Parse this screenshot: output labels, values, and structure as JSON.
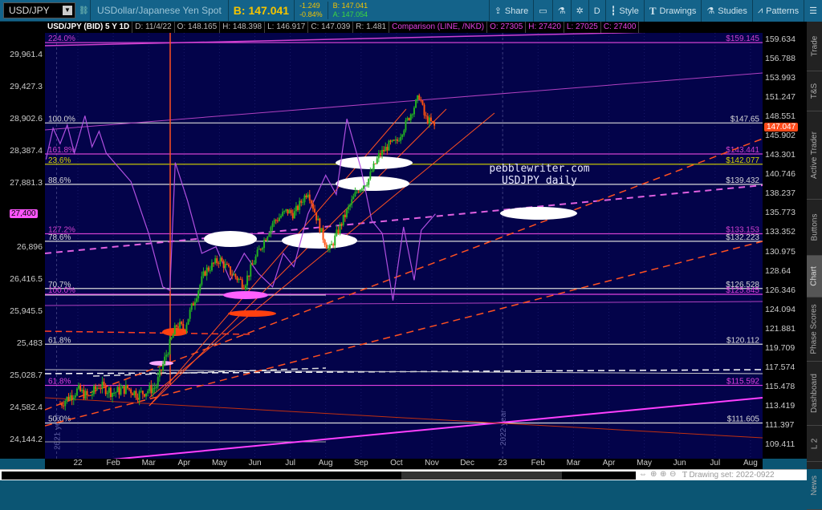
{
  "toolbar": {
    "symbol": "USD/JPY",
    "description": "USDollar/Japanese Yen Spot",
    "bid_big": "B: 147.041",
    "change": "-1.249",
    "change_pct": "-0.84%",
    "bid": "B: 147.041",
    "ask": "A: 147.054",
    "share": "Share",
    "aggregation": "D",
    "style": "Style",
    "drawings": "Drawings",
    "studies": "Studies",
    "patterns": "Patterns"
  },
  "header": {
    "title": "USD/JPY (BID) 5 Y 1D",
    "date": "D: 11/4/22",
    "open": "O: 148.165",
    "high": "H: 148.398",
    "low": "L: 146.917",
    "close": "C: 147.039",
    "range": "R: 1.481",
    "comparison": "Comparison (LINE, /NKD)",
    "cmp_open": "O: 27305",
    "cmp_high": "H: 27420",
    "cmp_low": "L: 27025",
    "cmp_close": "C: 27400"
  },
  "right_axis": [
    "159.634",
    "156.788",
    "153.993",
    "151.247",
    "148.551",
    "145.902",
    "143.301",
    "140.746",
    "138.237",
    "135.773",
    "133.352",
    "130.975",
    "128.64",
    "126.346",
    "124.094",
    "121.881",
    "119.709",
    "117.574",
    "115.478",
    "113.419",
    "111.397",
    "109.411"
  ],
  "left_axis": [
    "29,961.4",
    "29,427.3",
    "28,902.6",
    "28,387.4",
    "27,881.3",
    "26,896",
    "26,416.5",
    "25,945.5",
    "25,483",
    "25,028.7",
    "24,582.4",
    "24,144.2"
  ],
  "current_price_tag": "147.047",
  "comparison_tag": "27,400",
  "x_axis": [
    "22",
    "Feb",
    "Mar",
    "Apr",
    "May",
    "Jun",
    "Jul",
    "Aug",
    "Sep",
    "Oct",
    "Nov",
    "Dec",
    "23",
    "Feb",
    "Mar",
    "Apr",
    "May",
    "Jun",
    "Jul",
    "Aug"
  ],
  "year_marks": [
    "2021 year",
    "2022 year"
  ],
  "sidebar_tabs": [
    "Trade",
    "T&S",
    "Active Trader",
    "Buttons",
    "Chart",
    "Phase Scores",
    "Dashboard",
    "L 2",
    "News"
  ],
  "selected_tab": "Chart",
  "watermark": [
    "pebblewriter.com",
    "USDJPY daily"
  ],
  "drawing_set": "Drawing set: 2022-0922",
  "levels": [
    {
      "fib": "224.0%",
      "price": 159.14,
      "label": "$159.145",
      "color": "#d040d0"
    },
    {
      "fib": "100.0%",
      "price": 147.65,
      "label": "$147.65",
      "color": "#d8d8d8"
    },
    {
      "fib": "161.8%",
      "price": 143.44,
      "label": "$143.441",
      "color": "#d040d0"
    },
    {
      "fib": "23.6%",
      "price": 142.07,
      "label": "$142.077",
      "color": "#d8d800"
    },
    {
      "fib": "88.6%",
      "price": 139.43,
      "label": "$139.432",
      "color": "#d8d8d8"
    },
    {
      "fib": "127.2%",
      "price": 133.15,
      "label": "$133.153",
      "color": "#d040d0"
    },
    {
      "fib": "78.6%",
      "price": 132.22,
      "label": "$132.223",
      "color": "#d8d8d8"
    },
    {
      "fib": "70.7%",
      "price": 126.52,
      "label": "$126.528",
      "color": "#d8d8d8"
    },
    {
      "fib": "100.0%",
      "price": 125.84,
      "label": "$125.845",
      "color": "#e040e0"
    },
    {
      "fib": "61.8%",
      "price": 120.11,
      "label": "$120.112",
      "color": "#d8d8d8"
    },
    {
      "fib": "61.8%",
      "price": 115.59,
      "label": "$115.592",
      "color": "#e040e0"
    },
    {
      "fib": "50.0%",
      "price": 111.6,
      "label": "$111.605",
      "color": "#d8d8d8"
    }
  ],
  "chart_data": {
    "type": "candlestick",
    "title": "USD/JPY (BID) 5 Y 1D",
    "x_unit": "months since Jan 2022",
    "ylabel_right": "USD/JPY",
    "ylabel_left": "/NKD",
    "ylim_right": [
      109.411,
      159.634
    ],
    "ylim_left": [
      24144.2,
      29961.4
    ],
    "series": [
      {
        "name": "USD/JPY",
        "points": [
          [
            -0.5,
            113.6
          ],
          [
            0,
            115.1
          ],
          [
            0.3,
            114.3
          ],
          [
            0.6,
            115.6
          ],
          [
            1,
            114.8
          ],
          [
            1.4,
            115.3
          ],
          [
            1.7,
            114.6
          ],
          [
            2.2,
            115.4
          ],
          [
            2.5,
            119.0
          ],
          [
            2.8,
            122.4
          ],
          [
            3.0,
            121.8
          ],
          [
            3.3,
            125.3
          ],
          [
            3.6,
            128.6
          ],
          [
            4.0,
            130.0
          ],
          [
            4.3,
            128.5
          ],
          [
            4.7,
            127.0
          ],
          [
            5.0,
            130.0
          ],
          [
            5.5,
            134.5
          ],
          [
            5.9,
            136.0
          ],
          [
            6.1,
            135.6
          ],
          [
            6.5,
            138.6
          ],
          [
            6.9,
            133.0
          ],
          [
            7.1,
            131.0
          ],
          [
            7.5,
            135.0
          ],
          [
            7.9,
            138.7
          ],
          [
            8.2,
            140.0
          ],
          [
            8.5,
            143.2
          ],
          [
            8.8,
            144.7
          ],
          [
            9.0,
            145.0
          ],
          [
            9.4,
            148.9
          ],
          [
            9.65,
            151.5
          ],
          [
            9.8,
            148.4
          ],
          [
            10.0,
            147.6
          ],
          [
            10.1,
            147.04
          ]
        ]
      },
      {
        "name": "/NKD",
        "points": [
          [
            -0.9,
            28250
          ],
          [
            -0.7,
            28750
          ],
          [
            -0.5,
            28500
          ],
          [
            -0.3,
            28800
          ],
          [
            -0.1,
            28350
          ],
          [
            0.2,
            28950
          ],
          [
            0.4,
            28450
          ],
          [
            0.6,
            28700
          ],
          [
            0.8,
            28350
          ],
          [
            1.5,
            27900
          ],
          [
            2.0,
            27100
          ],
          [
            2.4,
            26300
          ],
          [
            2.6,
            26250
          ],
          [
            2.75,
            28200
          ],
          [
            3.1,
            27600
          ],
          [
            3.5,
            26800
          ],
          [
            3.9,
            26900
          ],
          [
            4.3,
            26400
          ],
          [
            4.7,
            26800
          ],
          [
            5.1,
            26500
          ],
          [
            5.5,
            26300
          ],
          [
            5.8,
            26800
          ],
          [
            6.1,
            26600
          ],
          [
            6.5,
            27400
          ],
          [
            7.0,
            28000
          ],
          [
            7.3,
            27700
          ],
          [
            7.6,
            28900
          ],
          [
            8.0,
            28100
          ],
          [
            8.3,
            27300
          ],
          [
            8.6,
            27100
          ],
          [
            8.9,
            26100
          ],
          [
            9.2,
            27200
          ],
          [
            9.5,
            26400
          ],
          [
            9.7,
            27150
          ],
          [
            10.1,
            27400
          ]
        ]
      }
    ]
  }
}
